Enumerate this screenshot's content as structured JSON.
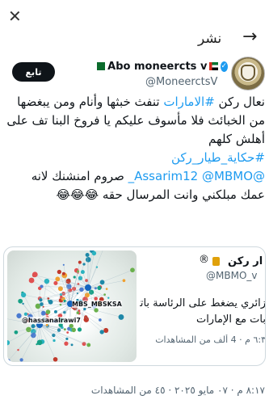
{
  "topbar": {
    "close_glyph": "✕",
    "title": "نشر",
    "back_glyph": "→"
  },
  "tweet": {
    "follow_label": "تابع",
    "display_name": "Abo moneercts v",
    "handle": "@MoneerctsV",
    "lines": [
      {
        "parts": [
          {
            "text": "نعال ركن ",
            "link": false
          },
          {
            "text": "#الامارات",
            "link": true
          },
          {
            "text": " تنفث خبثها  وأنام ومن يبغضها",
            "link": false
          }
        ]
      },
      {
        "parts": [
          {
            "text": "من الخبائث فلا مأسوف عليكم يا فروخ البنا  تف على",
            "link": false
          }
        ]
      },
      {
        "parts": [
          {
            "text": "أهلش كلهم",
            "link": false
          }
        ]
      },
      {
        "parts": [
          {
            "text": "#حكاية_طيار_ركن",
            "link": true
          }
        ]
      },
      {
        "parts": [
          {
            "text": "@Assarim12",
            "link": true
          },
          {
            "text": " ",
            "link": false
          },
          {
            "text": "@MBMO_",
            "link": true
          },
          {
            "text": "  صروم امنشنك لانه",
            "link": false
          }
        ]
      },
      {
        "parts": [
          {
            "text": "عمك مبلكني وانت المرسال حقه 😂😂😂",
            "link": false
          }
        ]
      }
    ]
  },
  "quoted": {
    "name": "ار ركن",
    "registered_mark": "®",
    "handle": "@MBMO_v",
    "text_line1": "زائري يضغط على الرئاسة باتخا",
    "text_line2": "بات مع الإمارات",
    "views": "٦:٣ م · 4 ألف من المشاهدات",
    "image_labels": [
      "MBS_MBSKSA",
      "@hassanalrawi7"
    ]
  },
  "meta": {
    "text": "٨:١٧ م · ٠٧ مايو ٢٠٢٥ · ٤٥ من المشاهدات"
  },
  "colors": {
    "link": "#1d9bf0",
    "follow_bg": "#0f1419",
    "muted": "#536471"
  }
}
